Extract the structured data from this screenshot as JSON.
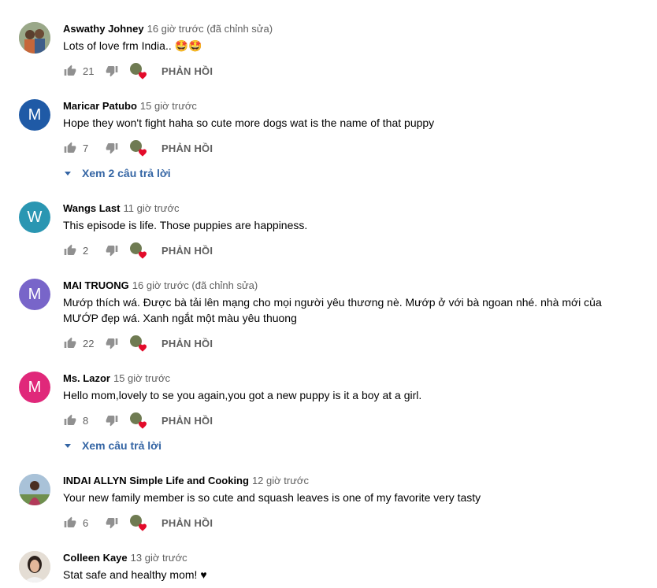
{
  "reply_label": "PHẢN HỒI",
  "comments": [
    {
      "author": "Aswathy Johney",
      "time": "16 giờ trước (đã chỉnh sửa)",
      "text": "Lots of love   frm India.. 🤩🤩",
      "likes": "21",
      "avatar": {
        "type": "photo",
        "bg": "#8a9a78"
      }
    },
    {
      "author": "Maricar Patubo",
      "time": "15 giờ trước",
      "text": "Hope they won't fight haha so cute more dogs wat is the name of that puppy",
      "likes": "7",
      "avatar": {
        "type": "letter",
        "letter": "M",
        "bg": "#1f5aa6"
      },
      "view_replies": "Xem 2 câu trả lời"
    },
    {
      "author": "Wangs Last",
      "time": "11 giờ trước",
      "text": "This episode is life. Those puppies are happiness.",
      "likes": "2",
      "avatar": {
        "type": "letter",
        "letter": "W",
        "bg": "#2a96b2"
      }
    },
    {
      "author": "MAI TRUONG",
      "time": "16 giờ trước (đã chỉnh sửa)",
      "text": "Mướp thích wá. Được bà  tải lên mạng cho mọi người yêu thương nè. Mướp ở với bà ngoan  nhé.  nhà mới của MƯỚP đẹp wá. Xanh ngắt một màu yêu thuong",
      "likes": "22",
      "avatar": {
        "type": "letter",
        "letter": "M",
        "bg": "#7865c9"
      }
    },
    {
      "author": "Ms. Lazor",
      "time": "15 giờ trước",
      "text": "Hello mom,lovely to se you again,you got a new puppy is it a boy at a girl.",
      "likes": "8",
      "avatar": {
        "type": "letter",
        "letter": "M",
        "bg": "#e0287a"
      },
      "view_replies": "Xem câu trả lời"
    },
    {
      "author": "INDAI ALLYN Simple Life and Cooking",
      "time": "12 giờ trước",
      "text": "Your new family member is so cute and squash leaves is one of my favorite very tasty",
      "likes": "6",
      "avatar": {
        "type": "photo",
        "bg": "#9bb3c9"
      }
    },
    {
      "author": "Colleen Kaye",
      "time": "13 giờ trước",
      "text": "Stat safe and healthy mom! ♥",
      "likes": "",
      "avatar": {
        "type": "photo",
        "bg": "#d9cfc4"
      }
    }
  ]
}
